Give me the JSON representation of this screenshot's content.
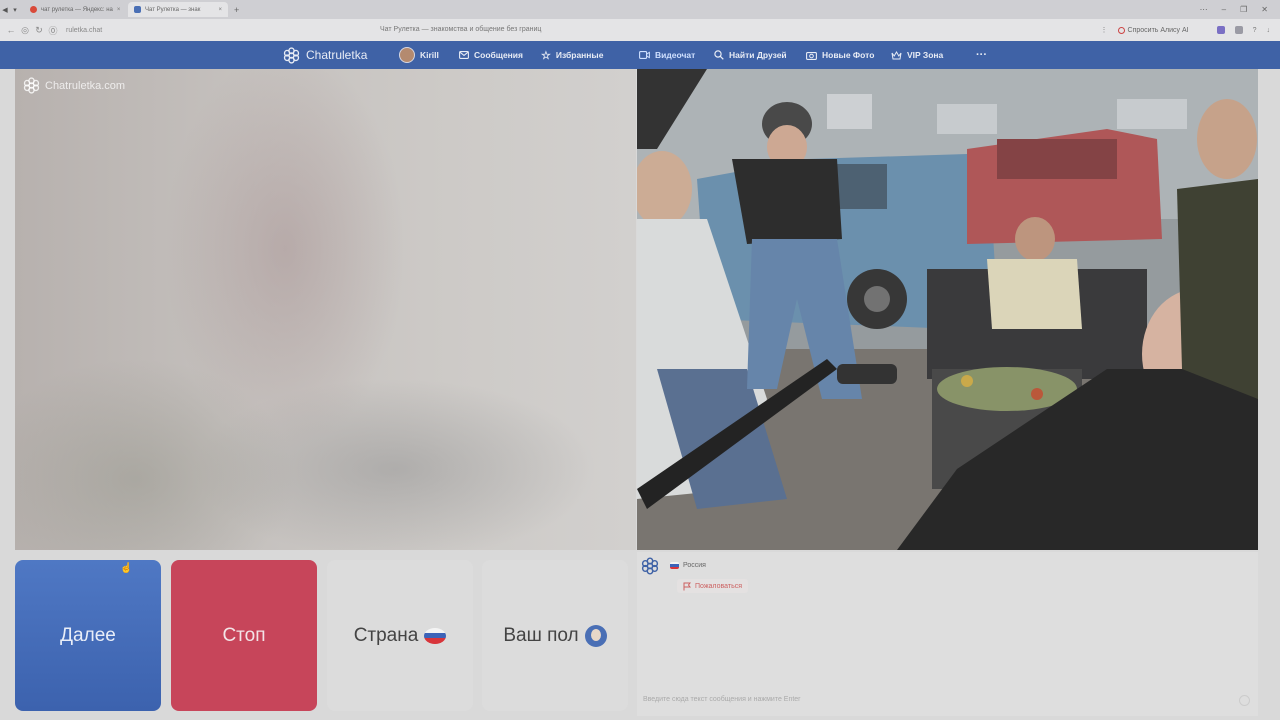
{
  "browser": {
    "tabs": [
      {
        "label": "чат рулетка — Яндекс: на",
        "active": false
      },
      {
        "label": "Чат Рулетка — знак",
        "active": true
      }
    ],
    "url": "ruletka.chat",
    "page_title": "Чат Рулетка — знакомства и общение без границ",
    "alice_label": "Спросить Алису AI"
  },
  "site": {
    "logo_text": "Chatruletka",
    "nav": {
      "user": "Kirill",
      "messages": "Сообщения",
      "favorites": "Избранные",
      "videochat": "Видеочат",
      "find_friends": "Найти Друзей",
      "new_photos": "Новые Фото",
      "vip": "VIP Зона",
      "more": "···"
    }
  },
  "video": {
    "watermark": "Chatruletka.com"
  },
  "buttons": {
    "next": "Далее",
    "stop": "Стоп",
    "country": "Страна",
    "gender": "Ваш пол"
  },
  "chat": {
    "country": "Россия",
    "report": "Пожаловаться",
    "input_placeholder": "Введите сюда текст сообщения и нажмите Enter"
  },
  "colors": {
    "nav_bg": "#3f62a6",
    "next_btn": "#3c62ae",
    "stop_btn": "#c7455a",
    "neutral_btn": "#dcdcdc"
  }
}
